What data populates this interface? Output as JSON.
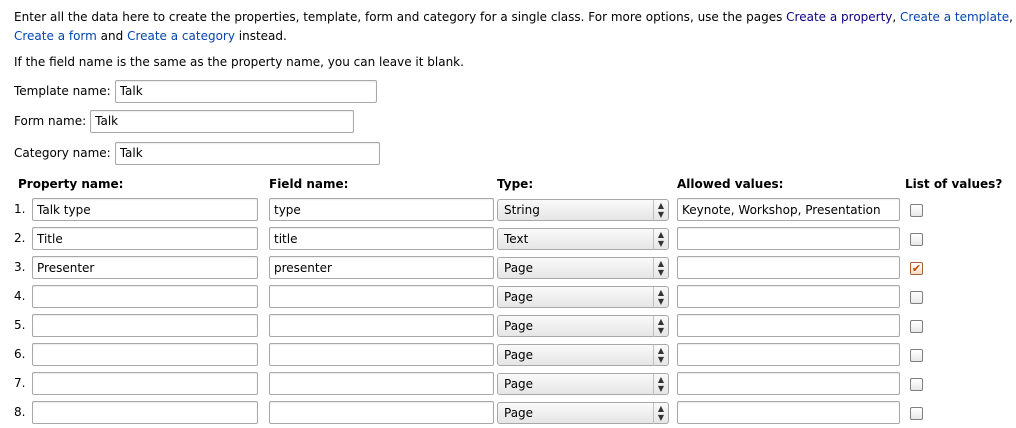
{
  "intro": {
    "text_before": "Enter all the data here to create the properties, template, form and category for a single class. For more options, use the pages ",
    "link_property": "Create a property",
    "sep1": ", ",
    "link_template": "Create a template",
    "sep2": ", ",
    "link_form": "Create a form",
    "sep3": " and ",
    "link_category": "Create a category",
    "text_after": " instead."
  },
  "blank_note": "If the field name is the same as the property name, you can leave it blank.",
  "template_name": {
    "label": "Template name:",
    "value": "Talk"
  },
  "form_name": {
    "label": "Form name:",
    "value": "Talk"
  },
  "category_name": {
    "label": "Category name:",
    "value": "Talk"
  },
  "table": {
    "headers": {
      "property": "Property name:",
      "field": "Field name:",
      "type": "Type:",
      "allowed": "Allowed values:",
      "list": "List of values?"
    },
    "rows": [
      {
        "num": "1.",
        "property": "Talk type",
        "field": "type",
        "type": "String",
        "allowed": "Keynote, Workshop, Presentation",
        "list": false
      },
      {
        "num": "2.",
        "property": "Title",
        "field": "title",
        "type": "Text",
        "allowed": "",
        "list": false
      },
      {
        "num": "3.",
        "property": "Presenter",
        "field": "presenter",
        "type": "Page",
        "allowed": "",
        "list": true
      },
      {
        "num": "4.",
        "property": "",
        "field": "",
        "type": "Page",
        "allowed": "",
        "list": false
      },
      {
        "num": "5.",
        "property": "",
        "field": "",
        "type": "Page",
        "allowed": "",
        "list": false
      },
      {
        "num": "6.",
        "property": "",
        "field": "",
        "type": "Page",
        "allowed": "",
        "list": false
      },
      {
        "num": "7.",
        "property": "",
        "field": "",
        "type": "Page",
        "allowed": "",
        "list": false
      },
      {
        "num": "8.",
        "property": "",
        "field": "",
        "type": "Page",
        "allowed": "",
        "list": false
      }
    ]
  },
  "colors": {
    "link": "#0645ad",
    "visited_link": "#0b0080",
    "checkbox_accent": "#c14a05"
  }
}
